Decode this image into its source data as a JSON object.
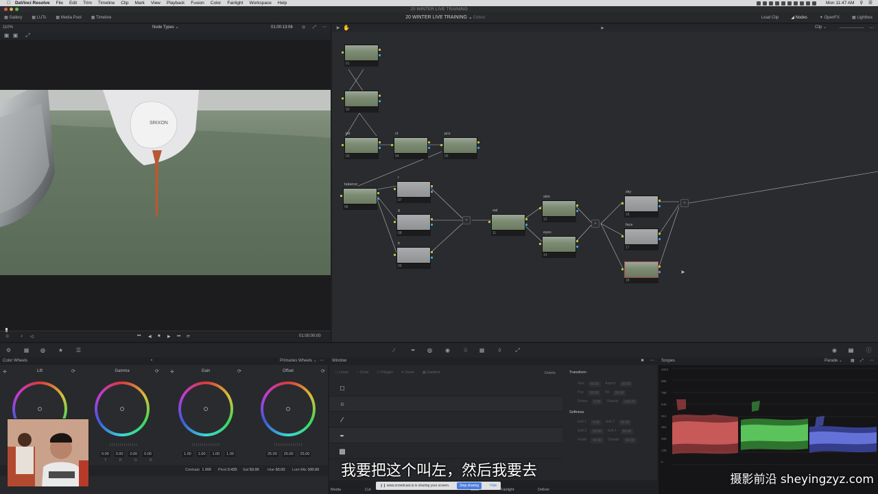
{
  "menubar": {
    "app_name": "DaVinci Resolve",
    "menus": [
      "File",
      "Edit",
      "Trim",
      "Timeline",
      "Clip",
      "Mark",
      "View",
      "Playback",
      "Fusion",
      "Color",
      "Fairlight",
      "Workspace",
      "Help"
    ],
    "clock": "Mon 11:47 AM"
  },
  "window": {
    "title": "20 WINTER LIVE TRAINING"
  },
  "toolbar": {
    "left_items": [
      "Gallery",
      "LUTs",
      "Media Pool",
      "Timeline"
    ],
    "project_title": "20 WINTER LIVE TRAINING",
    "project_sub": "Edited",
    "right_items": [
      "Lead Clip",
      "Nodes",
      "OpenFX",
      "Lightbox"
    ]
  },
  "viewer": {
    "zoom": "110%",
    "mode": "Node Types",
    "timecode_top": "01:00:13:06",
    "timecode_bottom": "01:00:00:00"
  },
  "node_editor": {
    "clip_mode": "Clip",
    "nodes": [
      {
        "label": "",
        "num": "01"
      },
      {
        "label": "",
        "num": "02"
      },
      {
        "label": "pd",
        "num": "03"
      },
      {
        "label": "ct",
        "num": "04"
      },
      {
        "label": "pcs",
        "num": "05"
      },
      {
        "label": "balance",
        "num": "06"
      },
      {
        "label": "r",
        "num": "07"
      },
      {
        "label": "g",
        "num": "08"
      },
      {
        "label": "b",
        "num": "09"
      },
      {
        "label": "sat",
        "num": "11"
      },
      {
        "label": "skin",
        "num": "12"
      },
      {
        "label": "eyes",
        "num": "14"
      },
      {
        "label": "sky",
        "num": "16"
      },
      {
        "label": "face",
        "num": "17"
      },
      {
        "label": "",
        "num": "18"
      }
    ]
  },
  "color_wheels": {
    "panel_title": "Color Wheels",
    "mode": "Primaries Wheels",
    "wheels": [
      {
        "name": "Lift",
        "values": [
          "0.00",
          "0.00",
          "0.00",
          "0.00"
        ]
      },
      {
        "name": "Gamma",
        "values": [
          "0.00",
          "0.00",
          "0.00",
          "0.00"
        ]
      },
      {
        "name": "Gain",
        "values": [
          "1.00",
          "1.00",
          "1.00",
          "1.00"
        ]
      },
      {
        "name": "Offset",
        "values": [
          "25.00",
          "25.00",
          "25.00",
          "25.00"
        ]
      }
    ],
    "channel_letters": [
      "Y",
      "R",
      "G",
      "B"
    ],
    "bottom_params": [
      {
        "label": "Contrast",
        "value": "1.000"
      },
      {
        "label": "Pivot",
        "value": "0.435"
      },
      {
        "label": "Sat",
        "value": "50.00"
      },
      {
        "label": "Hue",
        "value": "50.00"
      },
      {
        "label": "Lum Mix",
        "value": "100.00"
      }
    ]
  },
  "window_panel": {
    "title": "Window",
    "tools": [
      "Linear",
      "Circle",
      "Polygon",
      "Curve",
      "Gradient"
    ],
    "delete_label": "Delete",
    "transform_title": "Transform",
    "transform_fields": [
      {
        "label": "Size",
        "value": "50.00"
      },
      {
        "label": "Aspect",
        "value": "50.00"
      },
      {
        "label": "Pan",
        "value": "50.00"
      },
      {
        "label": "Tilt",
        "value": "50.00"
      },
      {
        "label": "Rotate",
        "value": "0.00"
      },
      {
        "label": "Opacity",
        "value": "100.00"
      }
    ],
    "softness_title": "Softness",
    "softness_fields": [
      {
        "label": "Soft 1",
        "value": "0.50"
      },
      {
        "label": "Soft 2",
        "value": "50.00"
      },
      {
        "label": "Soft 3",
        "value": "50.00"
      },
      {
        "label": "Soft 4",
        "value": "50.00"
      },
      {
        "label": "Inside",
        "value": "50.00"
      },
      {
        "label": "Outside",
        "value": "50.00"
      }
    ]
  },
  "scopes": {
    "title": "Scopes",
    "mode": "Parade",
    "axis": [
      "1023",
      "896",
      "768",
      "640",
      "512",
      "384",
      "256",
      "128",
      "0"
    ]
  },
  "screen_share": {
    "message": "www.crowdcast.io is sharing your screen.",
    "stop_label": "Stop sharing",
    "hide_label": "Hide"
  },
  "page_tabs": [
    "Media",
    "Cut",
    "Edit",
    "Fusion",
    "Color",
    "Fairlight",
    "Deliver"
  ],
  "subtitle": "我要把这个叫左，然后我要去",
  "watermark": "摄影前沿 sheyingzyz.com",
  "colors": {
    "accent": "#3da0d8",
    "pin_green": "#b8c24a"
  }
}
